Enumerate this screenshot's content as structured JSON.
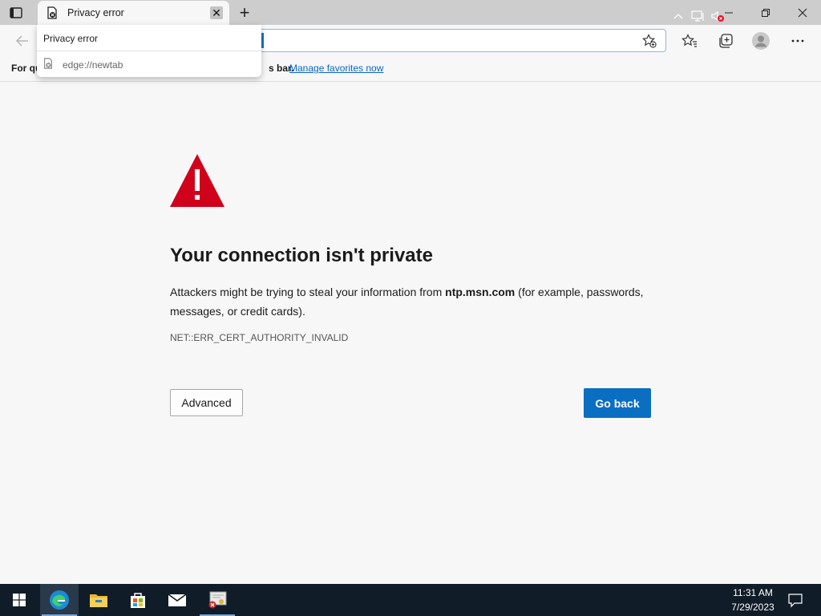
{
  "tab": {
    "title": "Privacy error",
    "close_glyph": "✕",
    "new_tab_glyph": "+"
  },
  "hover_card": {
    "title": "Privacy error",
    "url": "edge://newtab"
  },
  "favorites_bar": {
    "prefix": "For qu",
    "suffix": "s bar.",
    "link": "Manage favorites now"
  },
  "error": {
    "heading": "Your connection isn't private",
    "body_before": "Attackers might be trying to steal your information from ",
    "domain": "ntp.msn.com",
    "body_after": " (for example, passwords, messages, or credit cards).",
    "code": "NET::ERR_CERT_AUTHORITY_INVALID",
    "advanced_label": "Advanced",
    "goback_label": "Go back"
  },
  "taskbar": {
    "time": "11:31 AM",
    "date": "7/29/2023",
    "apps": [
      "windows-start-icon",
      "edge-icon",
      "file-explorer-icon",
      "store-icon",
      "mail-icon",
      "certificate-app-icon"
    ]
  },
  "colors": {
    "accent": "#0a6fc2",
    "warning_red": "#d0021b",
    "taskbar": "#101c27",
    "link": "#0a66c2"
  }
}
